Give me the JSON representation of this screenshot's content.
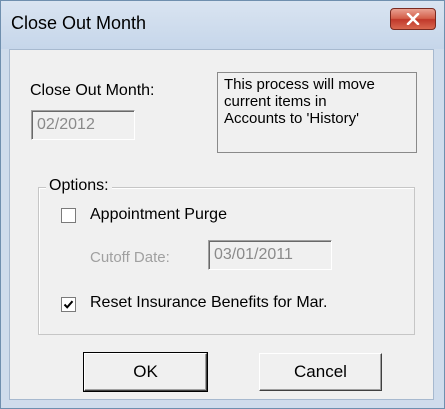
{
  "window": {
    "title": "Close Out Month"
  },
  "close_month": {
    "label": "Close Out Month:",
    "value": "02/2012"
  },
  "info": {
    "line1": "This process will move",
    "line2": "current items in",
    "line3": "Accounts to 'History'"
  },
  "options": {
    "group_label": "Options:",
    "appointment_purge": {
      "label": "Appointment Purge",
      "checked": false
    },
    "cutoff": {
      "label": "Cutoff Date:",
      "value": "03/01/2011"
    },
    "reset_benefits": {
      "label": "Reset Insurance Benefits for Mar.",
      "checked": true
    }
  },
  "buttons": {
    "ok": "OK",
    "cancel": "Cancel"
  }
}
